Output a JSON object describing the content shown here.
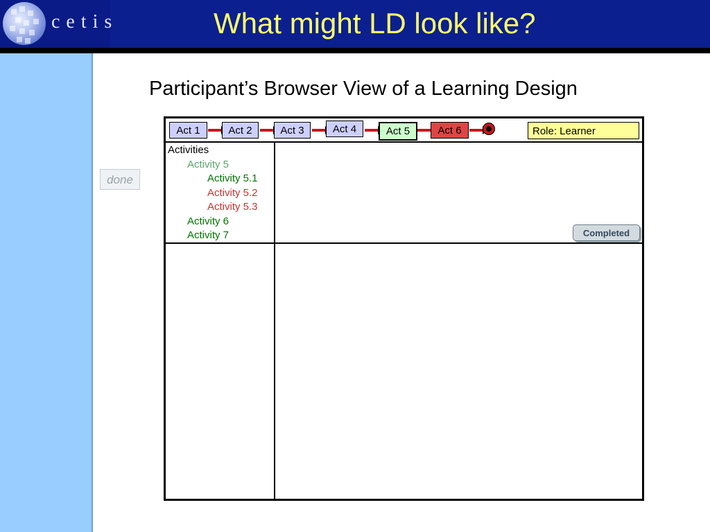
{
  "header": {
    "logo_text": "cetis",
    "title": "What might LD look like?"
  },
  "sidebar": {
    "done_label": "done"
  },
  "main": {
    "subtitle": "Participant’s  Browser View of a Learning Design",
    "acts": [
      {
        "label": "Act 1",
        "state": "pending"
      },
      {
        "label": "Act 2",
        "state": "pending"
      },
      {
        "label": "Act 3",
        "state": "pending"
      },
      {
        "label": "Act 4",
        "state": "pending"
      },
      {
        "label": "Act 5",
        "state": "current"
      },
      {
        "label": "Act 6",
        "state": "active"
      }
    ],
    "role_label": "Role: Learner",
    "tree": {
      "root": "Activities",
      "items": [
        {
          "label": "Activity 5",
          "level": 1,
          "status": "in-progress"
        },
        {
          "label": "Activity 5.1",
          "level": 2,
          "status": "completed"
        },
        {
          "label": "Activity 5.2",
          "level": 2,
          "status": "not-done"
        },
        {
          "label": "Activity 5.3",
          "level": 2,
          "status": "not-done"
        },
        {
          "label": "Activity 6",
          "level": 1,
          "status": "completed"
        },
        {
          "label": "Activity 7",
          "level": 1,
          "status": "completed"
        }
      ]
    },
    "completed_button": "Completed"
  },
  "colors": {
    "header_bg": "#0b1f8f",
    "title_color": "#ffff66",
    "left_panel": "#99ccff",
    "act_pending": "#cdd0ff",
    "act_current": "#ccffcc",
    "act_active": "#e04545",
    "role_bg": "#ffff99",
    "status_completed": "#007500",
    "status_in_progress": "#5aa56a",
    "status_not_done": "#d03030"
  }
}
